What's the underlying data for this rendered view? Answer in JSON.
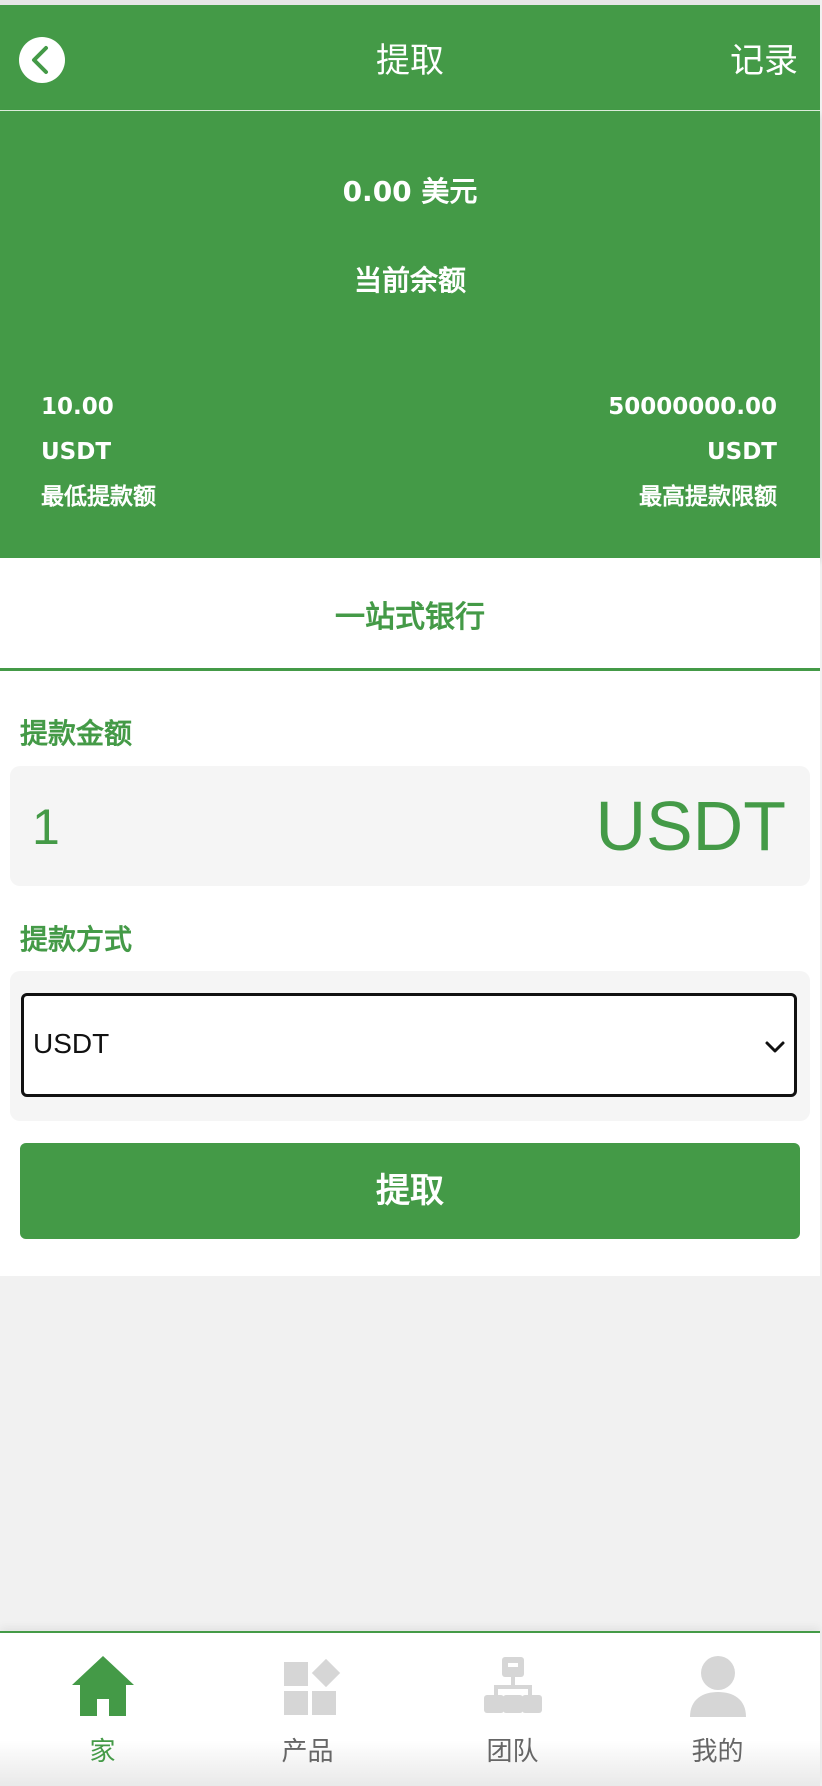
{
  "colors": {
    "accent": "#449a47",
    "inactive_icon": "#d6d6d6",
    "inactive_text": "#666666"
  },
  "header": {
    "title": "提取",
    "record_link": "记录",
    "back_icon": "chevron-left-icon"
  },
  "balance": {
    "amount": "0.00 美元",
    "label": "当前余额",
    "min": {
      "value": "10.00",
      "unit": "USDT",
      "label": "最低提款额"
    },
    "max": {
      "value": "50000000.00",
      "unit": "USDT",
      "label": "最高提款限额"
    }
  },
  "tab": {
    "label": "一站式银行"
  },
  "form": {
    "amount_label": "提款金额",
    "amount_value": "1",
    "amount_unit": "USDT",
    "method_label": "提款方式",
    "method_selected": "USDT",
    "submit_label": "提取"
  },
  "nav": {
    "items": [
      {
        "label": "家",
        "icon": "home-icon",
        "active": true
      },
      {
        "label": "产品",
        "icon": "products-grid-icon",
        "active": false
      },
      {
        "label": "团队",
        "icon": "team-hierarchy-icon",
        "active": false
      },
      {
        "label": "我的",
        "icon": "user-icon",
        "active": false
      }
    ]
  }
}
